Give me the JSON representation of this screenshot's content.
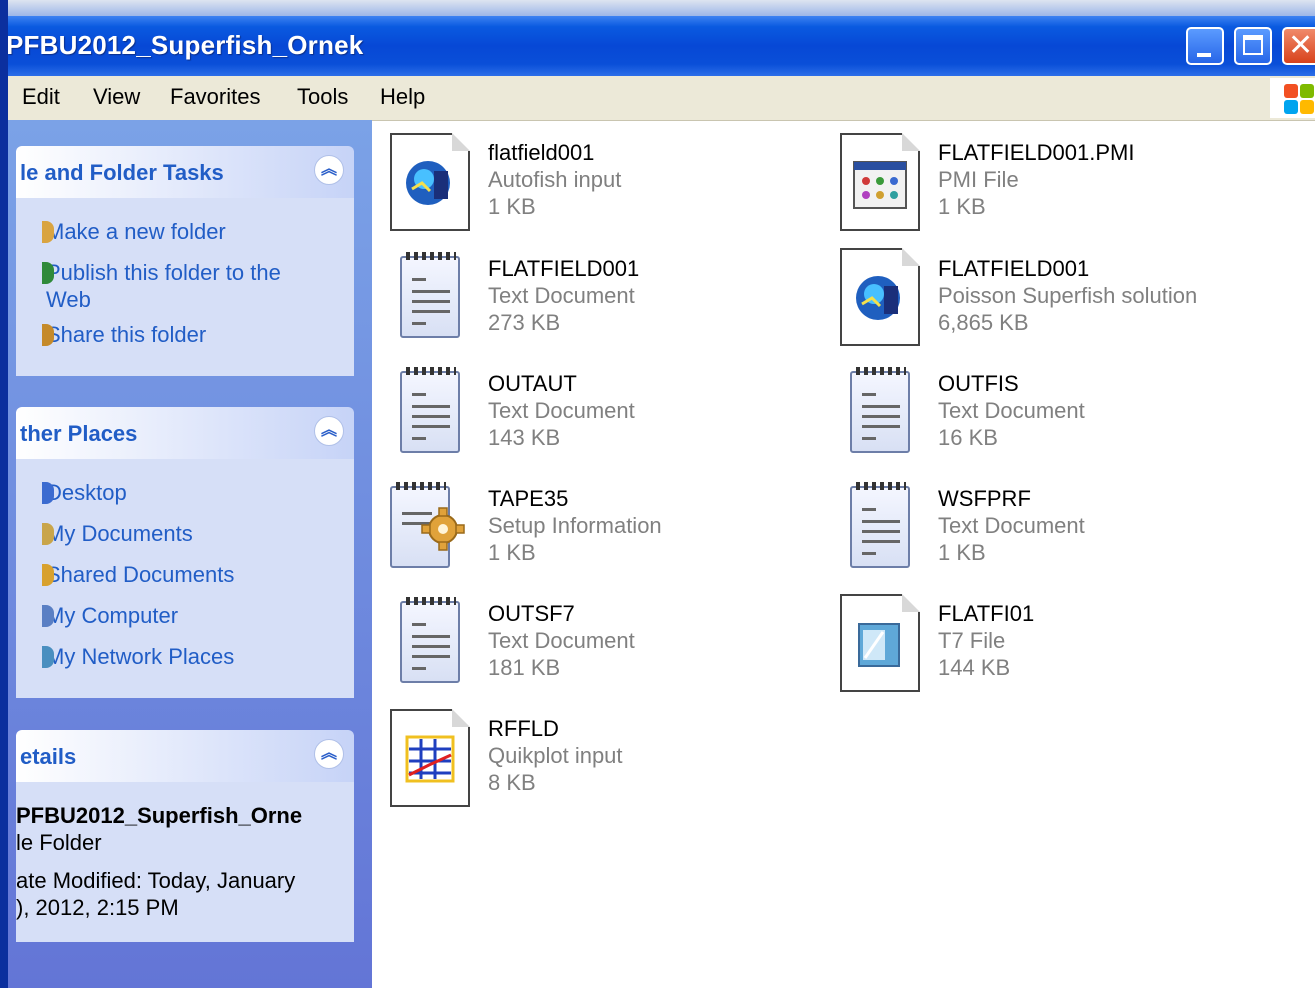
{
  "window": {
    "title": "PFBU2012_Superfish_Ornek"
  },
  "menu": [
    "Edit",
    "View",
    "Favorites",
    "Tools",
    "Help"
  ],
  "panels": {
    "file_tasks": {
      "title": "le and Folder Tasks",
      "items": [
        "Make a new folder",
        "Publish this folder to the",
        "Web",
        "Share this folder"
      ]
    },
    "other_places": {
      "title": "ther Places",
      "items": [
        "Desktop",
        "My Documents",
        "Shared Documents",
        "My Computer",
        "My Network Places"
      ]
    },
    "details": {
      "title": "etails",
      "name": "PFBU2012_Superfish_Orne",
      "type": "le Folder",
      "modified_line1": "ate Modified: Today, January",
      "modified_line2": "), 2012, 2:15 PM"
    }
  },
  "files": [
    {
      "name": "flatfield001",
      "type": "Autofish input",
      "size": "1 KB",
      "icon": "autofish-icon"
    },
    {
      "name": "FLATFIELD001.PMI",
      "type": "PMI File",
      "size": "1 KB",
      "icon": "pmi-icon"
    },
    {
      "name": "FLATFIELD001",
      "type": "Text Document",
      "size": "273 KB",
      "icon": "text-document-icon"
    },
    {
      "name": "FLATFIELD001",
      "type": "Poisson Superfish solution",
      "size": "6,865 KB",
      "icon": "superfish-icon"
    },
    {
      "name": "OUTAUT",
      "type": "Text Document",
      "size": "143 KB",
      "icon": "text-document-icon"
    },
    {
      "name": "OUTFIS",
      "type": "Text Document",
      "size": "16 KB",
      "icon": "text-document-icon"
    },
    {
      "name": "TAPE35",
      "type": "Setup Information",
      "size": "1 KB",
      "icon": "setup-icon"
    },
    {
      "name": "WSFPRF",
      "type": "Text Document",
      "size": "1 KB",
      "icon": "text-document-icon"
    },
    {
      "name": "OUTSF7",
      "type": "Text Document",
      "size": "181 KB",
      "icon": "text-document-icon"
    },
    {
      "name": "FLATFI01",
      "type": "T7 File",
      "size": "144 KB",
      "icon": "t7-icon"
    },
    {
      "name": "RFFLD",
      "type": "Quikplot input",
      "size": "8 KB",
      "icon": "quikplot-icon"
    }
  ],
  "colors": {
    "title_bar": "#0a4fd8",
    "link": "#215dc6",
    "secondary_text": "#808080"
  }
}
